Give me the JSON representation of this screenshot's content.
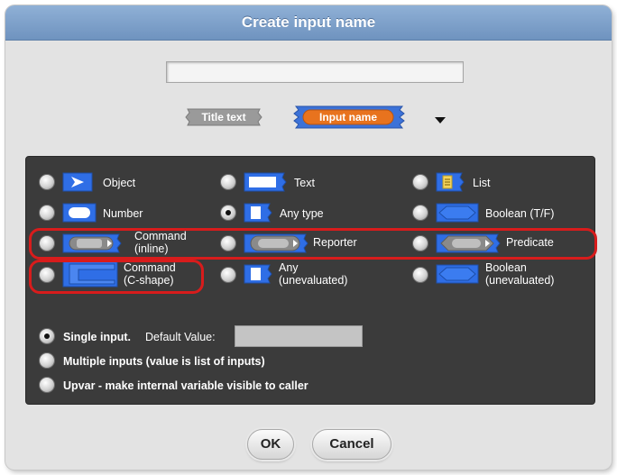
{
  "dialog": {
    "title": "Create input name",
    "name_value": "",
    "title_text_label": "Title text",
    "input_name_label": "Input name"
  },
  "types": {
    "object": "Object",
    "text": "Text",
    "list": "List",
    "number": "Number",
    "any_type": "Any type",
    "boolean": "Boolean (T/F)",
    "command_inline_1": "Command",
    "command_inline_2": "(inline)",
    "reporter": "Reporter",
    "predicate": "Predicate",
    "command_cshape_1": "Command",
    "command_cshape_2": "(C-shape)",
    "any_uneval_1": "Any",
    "any_uneval_2": "(unevaluated)",
    "boolean_uneval_1": "Boolean",
    "boolean_uneval_2": "(unevaluated)"
  },
  "selected_type": "Any type",
  "input_mode": {
    "single_label": "Single input.",
    "default_value_label": "Default Value:",
    "default_value": "",
    "multiple_label": "Multiple inputs (value is list of inputs)",
    "upvar_label": "Upvar - make internal variable visible to caller",
    "selected": "Single input."
  },
  "buttons": {
    "ok": "OK",
    "cancel": "Cancel"
  },
  "colors": {
    "title_bar": "#7fa2cc",
    "panel": "#3b3b3b",
    "slot_blue": "#2f6ee6",
    "input_name_orange": "#e8731e",
    "highlight_red": "#d81c1c"
  }
}
